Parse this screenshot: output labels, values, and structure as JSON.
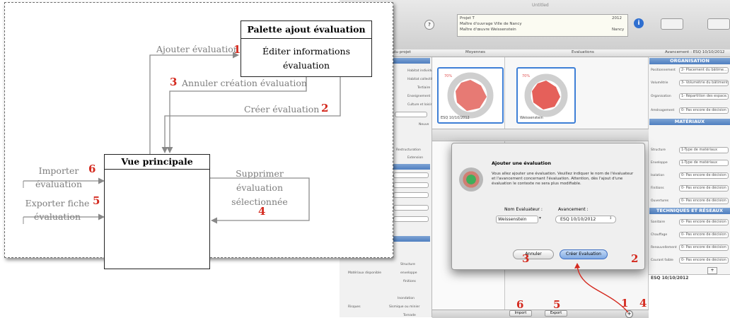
{
  "diagram": {
    "palette_title": "Palette ajout évaluation",
    "palette_body": "Éditer informations évaluation",
    "main_title": "Vue principale",
    "arrows": {
      "ajouter": "Ajouter évaluation",
      "annuler": "Annuler création évaluation",
      "creer": "Créer évaluation",
      "importer": "Importer évaluation",
      "exporter": "Exporter fiche évaluation",
      "supprimer": "Supprimer évaluation sélectionnée"
    },
    "numbers": {
      "n1": "1",
      "n2": "2",
      "n3": "3",
      "n4": "4",
      "n5": "5",
      "n6": "6"
    }
  },
  "screenshot": {
    "window_title": "Untitled",
    "project": {
      "line1": "Projet T",
      "line2": "Maître d'ouvrage  Ville de Nancy",
      "line3": "Maître d'œuvre  Weissenstein",
      "year": "2012",
      "city": "Nancy"
    },
    "columns": {
      "du_projet": "du projet",
      "moyennes": "Moyennes",
      "evaluations": "Evaluations",
      "avancement": "Avancement : ESQ 10/10/2012"
    },
    "thumb_labels": {
      "t1": "ESQ 10/10/2012",
      "t2": "Weissenstein"
    },
    "right_sections": {
      "organisation": "ORGANISATION",
      "materiaux": "MATÉRIAUX",
      "techniques": "TECHNIQUES ET RÉSEAUX"
    },
    "dialog": {
      "title": "Ajouter une évaluation",
      "text": "Vous allez ajouter une évaluation. Veuillez indiquer le nom de l'évaluateur et l'avancement concernant l'évaluation. Attention, dès l'ajout d'une évaluation le contexte ne sera plus modifiable.",
      "nom_label": "Nom Evaluateur :",
      "nom_value": "Weissenstein",
      "avanc_label": "Avancement :",
      "avanc_value": "ESQ 10/10/2012",
      "cancel": "Annuler",
      "create": "Créer Evaluation"
    },
    "bottom": {
      "import": "Import",
      "export": "Export",
      "list_item": "ESQ 10/10/2012"
    },
    "numbers": {
      "n1": "1",
      "n2": "2",
      "n3": "3",
      "n4": "4",
      "n5": "5",
      "n6": "6"
    }
  }
}
